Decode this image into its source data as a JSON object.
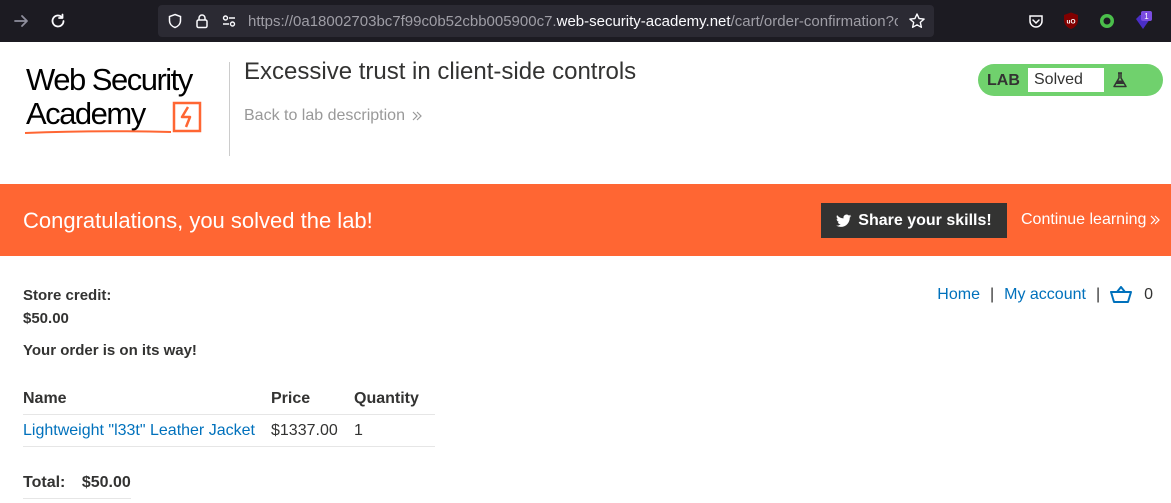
{
  "browser": {
    "url_prefix": "https://0a18002703bc7f99c0b52cbb005900c7.",
    "url_host": "web-security-academy.net",
    "url_path": "/cart/order-confirmation?o",
    "ext_badge": "1"
  },
  "header": {
    "logo_line1": "Web Security",
    "logo_line2": "Academy",
    "lab_title": "Excessive trust in client-side controls",
    "back_link": "Back to lab description",
    "lab_badge_label": "LAB",
    "lab_badge_status": "Solved"
  },
  "banner": {
    "title": "Congratulations, you solved the lab!",
    "share_label": "Share your skills!",
    "continue_label": "Continue learning"
  },
  "account": {
    "store_credit_label": "Store credit:",
    "store_credit_value": "$50.00",
    "order_message": "Your order is on its way!"
  },
  "nav": {
    "home": "Home",
    "separator": "|",
    "my_account": "My account",
    "cart_count": "0"
  },
  "order": {
    "columns": [
      "Name",
      "Price",
      "Quantity"
    ],
    "rows": [
      {
        "name": "Lightweight \"l33t\" Leather Jacket",
        "price": "$1337.00",
        "quantity": "1"
      }
    ],
    "total_label": "Total:",
    "total_value": "$50.00"
  },
  "colors": {
    "accent_orange": "#ff6633",
    "badge_green": "#70d16d",
    "link_blue": "#0071bc",
    "browser_dark": "#1c1b22"
  }
}
